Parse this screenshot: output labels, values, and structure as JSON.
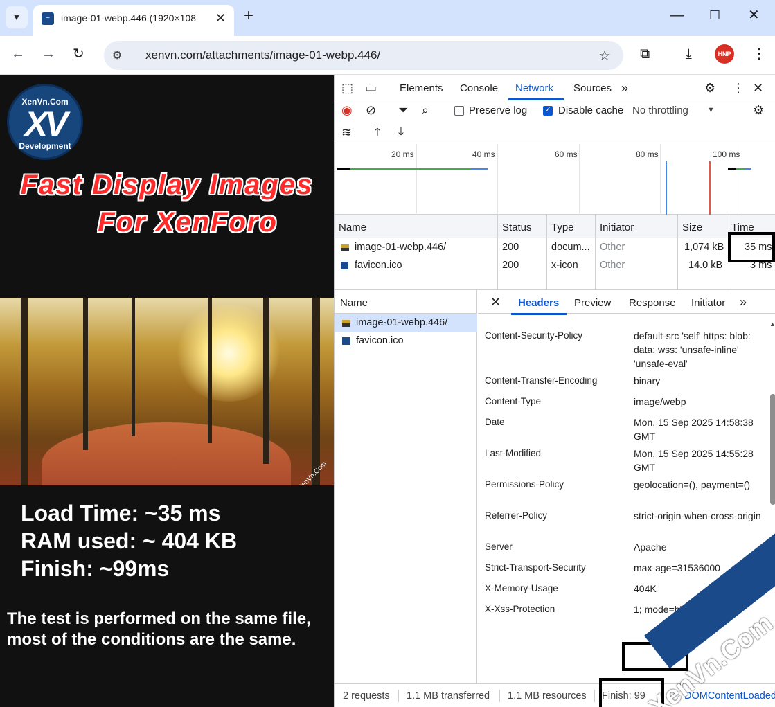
{
  "browser": {
    "tab_title": "image-01-webp.446 (1920×108",
    "url": "xenvn.com/attachments/image-01-webp.446/",
    "profile_badge": "HNP"
  },
  "left": {
    "logo_top": "XenVn.Com",
    "logo_mark": "XV",
    "logo_bottom": "Development",
    "headline_1": "Fast Display Images",
    "headline_2": "For XenForo",
    "photo_watermark": "XenVn.Com",
    "stat_load": "Load Time: ~35 ms",
    "stat_ram": "RAM used: ~ 404 KB",
    "stat_finish": "Finish: ~99ms",
    "note_1": "The test is performed on the same file,",
    "note_2": "most of the conditions are the same."
  },
  "devtools": {
    "tabs": [
      "Elements",
      "Console",
      "Network",
      "Sources"
    ],
    "active_tab": "Network",
    "preserve_log": "Preserve log",
    "disable_cache": "Disable cache",
    "throttling": "No throttling",
    "timeline_ticks": [
      "20 ms",
      "40 ms",
      "60 ms",
      "80 ms",
      "100 ms"
    ],
    "columns": [
      "Name",
      "Status",
      "Type",
      "Initiator",
      "Size",
      "Time"
    ],
    "requests": [
      {
        "name": "image-01-webp.446/",
        "status": "200",
        "type": "docum...",
        "initiator": "Other",
        "size": "1,074 kB",
        "time": "35 ms"
      },
      {
        "name": "favicon.ico",
        "status": "200",
        "type": "x-icon",
        "initiator": "Other",
        "size": "14.0 kB",
        "time": "3 ms"
      }
    ],
    "name_panel_header": "Name",
    "detail_tabs": [
      "Headers",
      "Preview",
      "Response",
      "Initiator"
    ],
    "headers": [
      {
        "key": "Content-Security-Policy",
        "value": "default-src 'self' https: blob: data: wss: 'unsafe-inline' 'unsafe-eval'"
      },
      {
        "key": "Content-Transfer-Encoding",
        "value": "binary"
      },
      {
        "key": "Content-Type",
        "value": "image/webp"
      },
      {
        "key": "Date",
        "value": "Mon, 15 Sep 2025 14:58:38 GMT"
      },
      {
        "key": "Last-Modified",
        "value": "Mon, 15 Sep 2025 14:55:28 GMT"
      },
      {
        "key": "Permissions-Policy",
        "value": "geolocation=(), payment=()"
      },
      {
        "key": "Referrer-Policy",
        "value": "strict-origin-when-cross-origin"
      },
      {
        "key": "Server",
        "value": "Apache"
      },
      {
        "key": "Strict-Transport-Security",
        "value": "max-age=31536000"
      },
      {
        "key": "X-Memory-Usage",
        "value": "404K"
      },
      {
        "key": "X-Xss-Protection",
        "value": "1; mode=block"
      }
    ],
    "status_bar": {
      "requests": "2 requests",
      "transferred": "1.1 MB transferred",
      "resources": "1.1 MB resources",
      "finish": "Finish: 99",
      "dcl": "DOMContentLoaded:"
    }
  },
  "watermark": "XenVn.Com"
}
